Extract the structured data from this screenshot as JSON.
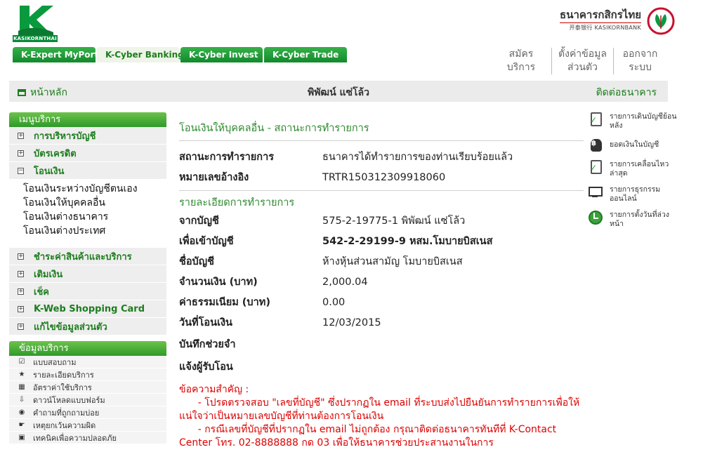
{
  "header": {
    "logo_text": "KASIKORNTHAI",
    "bank_name_th": "ธนาคารกสิกรไทย",
    "bank_name_en": "开泰银行 KASIKORNBANK",
    "tabs": [
      {
        "label": "K-Expert MyPort",
        "active": false
      },
      {
        "label": "K-Cyber Banking",
        "active": true
      },
      {
        "label": "K-Cyber Invest",
        "active": false
      },
      {
        "label": "K-Cyber Trade",
        "active": false
      }
    ],
    "links": {
      "register": "สมัครบริการ",
      "settings": "ตั้งค่าข้อมูลส่วนตัว",
      "logout": "ออกจากระบบ"
    }
  },
  "nav": {
    "home": "หน้าหลัก",
    "user_name": "พิพัฒน์ แซ่โล้ว",
    "contact": "ติดต่อธนาคาร"
  },
  "sidebar": {
    "menu_title": "เมนูบริการ",
    "items": [
      {
        "label": "การบริหารบัญชี",
        "expanded": false
      },
      {
        "label": "บัตรเครดิต",
        "expanded": false
      },
      {
        "label": "โอนเงิน",
        "expanded": true
      }
    ],
    "transfer_submenu": [
      "โอนเงินระหว่างบัญชีตนเอง",
      "โอนเงินให้บุคคลอื่น",
      "โอนเงินต่างธนาคาร",
      "โอนเงินต่างประเทศ"
    ],
    "items_after": [
      {
        "label": "ชำระค่าสินค้าและบริการ"
      },
      {
        "label": "เติมเงิน"
      },
      {
        "label": "เช็ค"
      },
      {
        "label": "K-Web Shopping Card"
      },
      {
        "label": "แก้ไขข้อมูลส่วนตัว"
      }
    ],
    "info_title": "ข้อมูลบริการ",
    "info_items": [
      {
        "label": "แบบสอบถาม",
        "icon": "checkbox-icon"
      },
      {
        "label": "รายละเอียดบริการ",
        "icon": "star-icon"
      },
      {
        "label": "อัตราค่าใช้บริการ",
        "icon": "calculator-icon"
      },
      {
        "label": "ดาวน์โหลดแบบฟอร์ม",
        "icon": "download-icon"
      },
      {
        "label": "คำถามที่ถูกถามบ่อย",
        "icon": "question-icon"
      },
      {
        "label": "เหตุยกเว้นความผิด",
        "icon": "hand-icon"
      },
      {
        "label": "เทคนิคเพื่อความปลอดภัย",
        "icon": "lock-icon"
      }
    ]
  },
  "main": {
    "title": "โอนเงินให้บุคคลอื่น - สถานะการทำรายการ",
    "status_label": "สถานะการทำรายการ",
    "status_value": "ธนาคารได้ทำรายการของท่านเรียบร้อยแล้ว",
    "ref_label": "หมายเลขอ้างอิง",
    "ref_value": "TRTR150312309918060",
    "details_title": "รายละเอียดการทำรายการ",
    "from_label": "จากบัญชี",
    "from_value": "575-2-19775-1 พิพัฒน์ แซ่โล้ว",
    "to_label": "เพื่อเข้าบัญชี",
    "to_value": "542-2-29199-9 หสม.โมบายบิสเนส",
    "account_name_label": "ชื่อบัญชี",
    "account_name_value": "ห้างหุ้นส่วนสามัญ โมบายบิสเนส",
    "amount_label": "จำนวนเงิน (บาท)",
    "amount_value": "2,000.04",
    "fee_label": "ค่าธรรมเนียม (บาท)",
    "fee_value": "0.00",
    "date_label": "วันที่โอนเงิน",
    "date_value": "12/03/2015",
    "memo_label": "บันทึกช่วยจำ",
    "notify_label": "แจ้งผู้รับโอน",
    "notice_label": "ข้อความสำคัญ :",
    "notice_1": "      - โปรดตรวจสอบ \"เลขที่บัญชี\" ซึ่งปรากฏใน email ที่ระบบส่งไปยืนยันการทำรายการเพื่อให้แน่ใจว่าเป็นหมายเลขบัญชีที่ท่านต้องการโอนเงิน",
    "notice_2": "      - กรณีเลขที่บัญชีที่ปรากฏใน email ไม่ถูกต้อง กรุณาติดต่อธนาคารทันทีที่ K-Contact Center โทร. 02-8888888 กด 03 เพื่อให้ธนาคารช่วยประสานงานในการ"
  },
  "right_links": [
    {
      "label": "รายการเดินบัญชีย้อนหลัง",
      "icon": "statement-icon"
    },
    {
      "label": "ยอดเงินในบัญชี",
      "icon": "money-bag-icon"
    },
    {
      "label": "รายการเคลื่อนไหวล่าสุด",
      "icon": "recent-icon"
    },
    {
      "label": "รายการธุรกรรมออนไลน์",
      "icon": "monitor-icon"
    },
    {
      "label": "รายการตั้งวันที่ล่วงหน้า",
      "icon": "clock-icon"
    }
  ],
  "colors": {
    "brand_green": "#1e7d1e",
    "notice_red": "#dd0000"
  }
}
